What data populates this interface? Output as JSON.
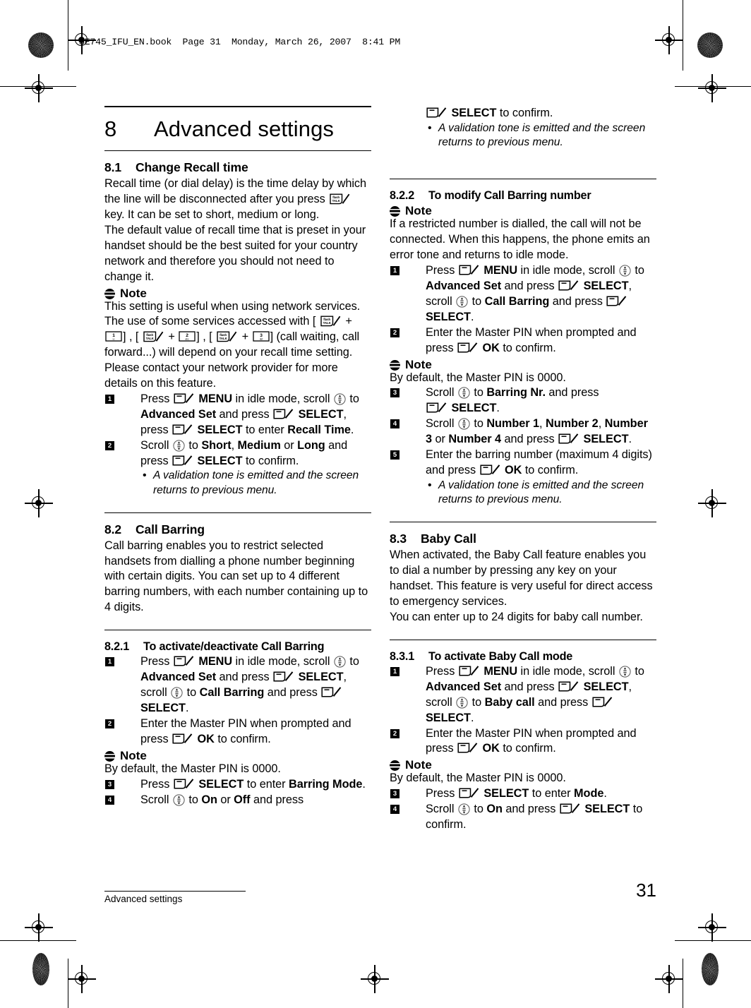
{
  "book_header": "SE745_IFU_EN.book  Page 31  Monday, March 26, 2007  8:41 PM",
  "footer": {
    "running_head": "Advanced settings",
    "page_number": "31"
  },
  "chapter": {
    "number": "8",
    "title": "Advanced settings"
  },
  "icons": {
    "softkey": "softkey-icon",
    "navkey": "navigation-key-icon",
    "flashkey_label_top": "flash",
    "flashkey_label_bottom": "TALK",
    "note": "note-icon"
  },
  "sections": {
    "s81": {
      "number": "8.1",
      "title": "Change Recall time",
      "p1_a": "Recall time (or dial delay) is the time delay by which the line will be disconnected after you press ",
      "p1_b": " key. It can be set to short, medium or long.",
      "p2": "The default value of recall time that is preset in your handset should be the best suited for your country network and therefore you should not need to change it.",
      "note_label": "Note",
      "p3_a": "This setting is useful when using network services. The use of some services accessed with [",
      "p3_b": "] , [",
      "p3_c": "] , [",
      "p3_d": "] (call waiting, call forward...) will depend on your recall time setting. Please contact your network provider for more details on this feature.",
      "key1": "1",
      "key2": "2",
      "key3": "3",
      "steps": [
        {
          "n": "1",
          "t1": "Press ",
          "b1": "MENU",
          "t2": " in idle mode, scroll ",
          "t3": " to ",
          "b2": "Advanced Set",
          "t4": " and press ",
          "b3": "SELECT",
          "t5": ", press ",
          "b4": "SELECT",
          "t6": " to enter ",
          "b5": "Recall Time",
          "t7": "."
        },
        {
          "n": "2",
          "t1": "Scroll ",
          "t2": " to ",
          "b1": "Short",
          "t3": ", ",
          "b2": "Medium",
          "t4": " or ",
          "b3": "Long",
          "t5": " and press ",
          "b4": "SELECT",
          "t6": " to confirm."
        }
      ],
      "bullet": "A validation tone is emitted and the screen returns to previous menu."
    },
    "s82": {
      "number": "8.2",
      "title": "Call Barring",
      "p1": "Call barring enables you to restrict selected handsets from dialling a phone number beginning with certain digits. You can set up to 4 different barring numbers, with each number containing up to 4 digits."
    },
    "s821": {
      "number": "8.2.1",
      "title": "To activate/deactivate Call Barring",
      "note_label": "Note",
      "note_text": "By default, the Master PIN is 0000.",
      "steps": [
        {
          "n": "1",
          "t1": "Press ",
          "b1": "MENU",
          "t2": " in idle mode, scroll ",
          "t3": " to ",
          "b2": "Advanced Set",
          "t4": " and press ",
          "b3": "SELECT",
          "t5": ", scroll ",
          "t6": " to ",
          "b4": "Call Barring",
          "t7": " and press ",
          "b5": "SELECT",
          "t8": "."
        },
        {
          "n": "2",
          "t1": "Enter the Master PIN when prompted and press ",
          "b1": "OK",
          "t2": " to confirm."
        },
        {
          "n": "3",
          "t1": "Press ",
          "b1": "SELECT",
          "t2": " to enter ",
          "b2": "Barring Mode",
          "t3": "."
        },
        {
          "n": "4",
          "t1": "Scroll ",
          "t2": " to ",
          "b1": "On",
          "t3": " or ",
          "b2": "Off",
          "t4": " and press"
        }
      ]
    },
    "s821_cont": {
      "t1": "SELECT",
      "t2": " to confirm.",
      "bullet": "A validation tone is emitted and the screen returns to previous menu."
    },
    "s822": {
      "number": "8.2.2",
      "title": "To modify Call Barring number",
      "note_label": "Note",
      "note_text": "If a restricted number is dialled, the call will not be connected. When this happens, the phone emits an error tone and returns to idle mode.",
      "note2_label": "Note",
      "note2_text": "By default, the Master PIN is 0000.",
      "steps": [
        {
          "n": "1",
          "t1": "Press ",
          "b1": "MENU",
          "t2": " in idle mode, scroll ",
          "t3": " to ",
          "b2": "Advanced Set",
          "t4": " and press ",
          "b3": "SELECT",
          "t5": ", scroll ",
          "t6": " to ",
          "b4": "Call Barring",
          "t7": " and press ",
          "b5": "SELECT",
          "t8": "."
        },
        {
          "n": "2",
          "t1": "Enter the Master PIN when prompted and press ",
          "b1": "OK",
          "t2": " to confirm."
        },
        {
          "n": "3",
          "t1": "Scroll ",
          "t2": " to ",
          "b1": "Barring Nr.",
          "t3": " and press ",
          "b2": "SELECT",
          "t4": "."
        },
        {
          "n": "4",
          "t1": "Scroll ",
          "t2": " to ",
          "b1": "Number 1",
          "t3": ", ",
          "b2": "Number 2",
          "t4": ", ",
          "b3": "Number 3",
          "t5": " or ",
          "b4": "Number 4",
          "t6": " and press ",
          "b5": "SELECT",
          "t7": "."
        },
        {
          "n": "5",
          "t1": "Enter the barring number (maximum 4 digits) and press ",
          "b1": "OK",
          "t2": " to confirm."
        }
      ],
      "bullet": "A validation tone is emitted and the screen returns to previous menu."
    },
    "s83": {
      "number": "8.3",
      "title": "Baby Call",
      "p1": "When activated, the Baby Call feature enables you to dial a number by pressing any key on your handset. This feature is very useful for direct access to emergency services.",
      "p2": "You can enter up to 24 digits for baby call number."
    },
    "s831": {
      "number": "8.3.1",
      "title": "To activate Baby Call mode",
      "note_label": "Note",
      "note_text": "By default, the Master PIN is 0000.",
      "steps": [
        {
          "n": "1",
          "t1": "Press ",
          "b1": "MENU",
          "t2": " in idle mode, scroll ",
          "t3": " to ",
          "b2": "Advanced Set",
          "t4": " and press ",
          "b3": "SELECT",
          "t5": ", scroll ",
          "t6": " to ",
          "b4": "Baby call",
          "t7": " and press ",
          "b5": "SELECT",
          "t8": "."
        },
        {
          "n": "2",
          "t1": "Enter the Master PIN when prompted and press ",
          "b1": "OK",
          "t2": " to confirm."
        },
        {
          "n": "3",
          "t1": "Press ",
          "b1": "SELECT",
          "t2": " to enter ",
          "b2": "Mode",
          "t3": "."
        },
        {
          "n": "4",
          "t1": "Scroll ",
          "t2": " to ",
          "b1": "On",
          "t3": " and press ",
          "b2": "SELECT",
          "t4": " to confirm."
        }
      ]
    }
  }
}
